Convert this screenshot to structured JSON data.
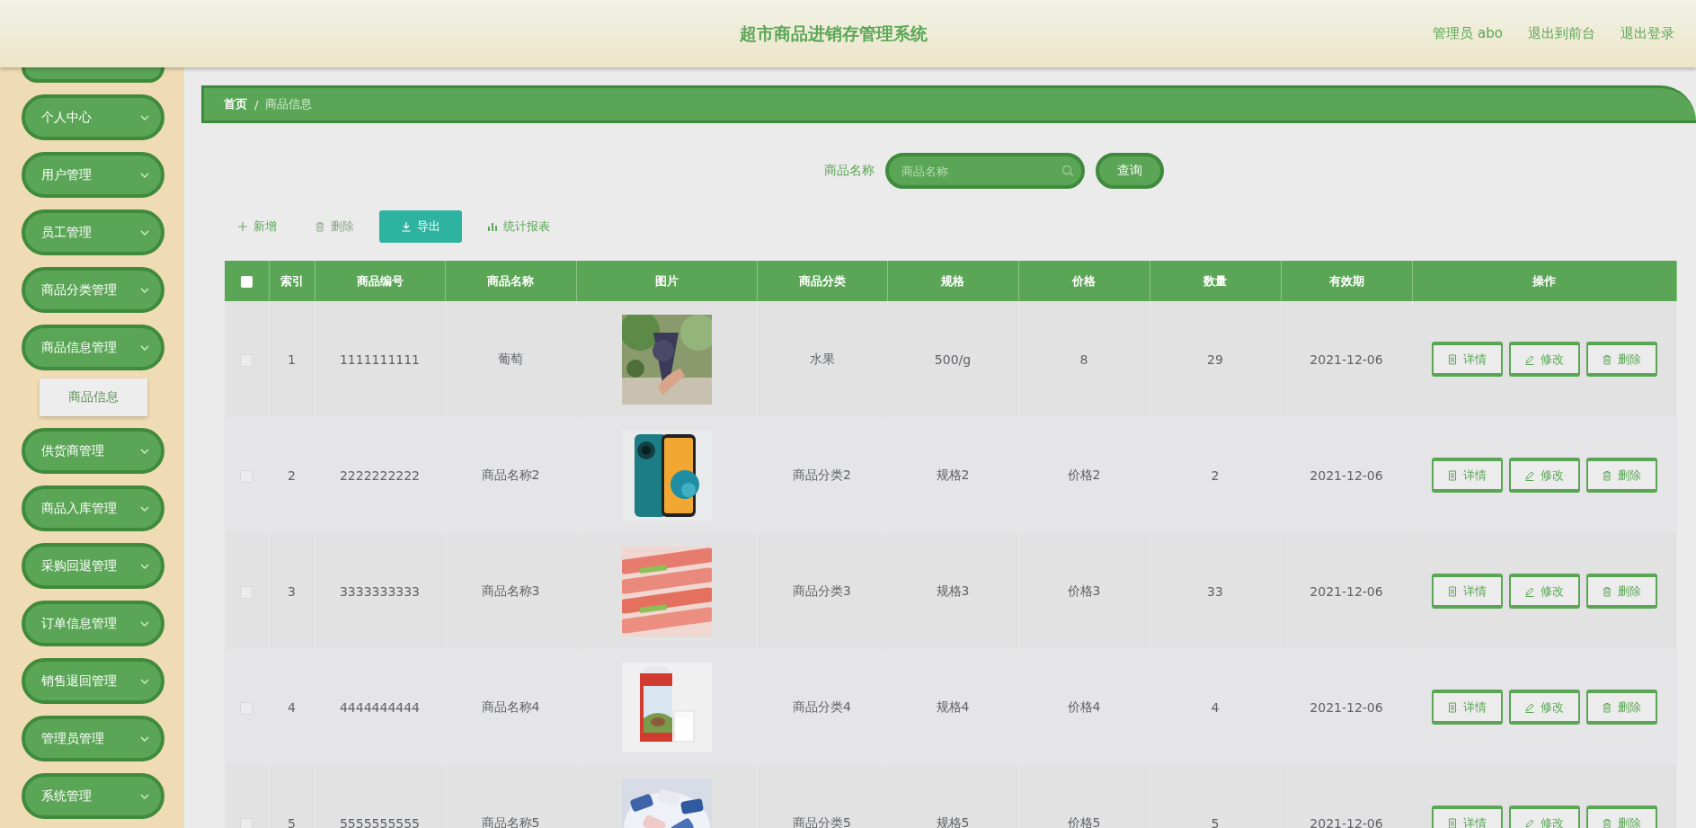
{
  "header": {
    "title": "超市商品进销存管理系统",
    "links": [
      "管理员 abo",
      "退出到前台",
      "退出登录"
    ]
  },
  "sidebar": {
    "items": [
      {
        "label": "个人中心"
      },
      {
        "label": "用户管理"
      },
      {
        "label": "员工管理"
      },
      {
        "label": "商品分类管理"
      },
      {
        "label": "商品信息管理",
        "children": [
          {
            "label": "商品信息",
            "selected": false
          }
        ]
      },
      {
        "label": "供货商管理"
      },
      {
        "label": "商品入库管理"
      },
      {
        "label": "采购回退管理"
      },
      {
        "label": "订单信息管理"
      },
      {
        "label": "销售退回管理"
      },
      {
        "label": "管理员管理"
      },
      {
        "label": "系统管理"
      }
    ]
  },
  "breadcrumb": {
    "separator": "/",
    "items": [
      {
        "label": "首页",
        "current": false
      },
      {
        "label": "商品信息",
        "current": true
      }
    ]
  },
  "search": {
    "label": "商品名称",
    "placeholder": "商品名称",
    "button": "查询"
  },
  "toolbar": [
    {
      "kind": "add",
      "label": "新增"
    },
    {
      "kind": "delete",
      "label": "删除"
    },
    {
      "kind": "export",
      "label": "导出"
    },
    {
      "kind": "chart",
      "label": "统计报表"
    }
  ],
  "table": {
    "header_checked": false,
    "columns": [
      "索引",
      "商品编号",
      "商品名称",
      "图片",
      "商品分类",
      "规格",
      "价格",
      "数量",
      "有效期",
      "操作"
    ],
    "rows": [
      {
        "checked": false,
        "index": "1",
        "code": "1111111111",
        "name": "葡萄",
        "picture": {
          "kind": "picture"
        },
        "category": "水果",
        "spec": "500/g",
        "price": "8",
        "quantity": "29",
        "expiry": "2021-12-06",
        "actions": [
          {
            "kind": "detail",
            "label": "详情"
          },
          {
            "kind": "edit",
            "label": "修改"
          },
          {
            "kind": "delete",
            "label": "删除"
          }
        ]
      },
      {
        "checked": false,
        "index": "2",
        "code": "2222222222",
        "name": "商品名称2",
        "picture": {
          "kind": "picture"
        },
        "category": "商品分类2",
        "spec": "规格2",
        "price": "价格2",
        "quantity": "2",
        "expiry": "2021-12-06",
        "actions": [
          {
            "kind": "detail",
            "label": "详情"
          },
          {
            "kind": "edit",
            "label": "修改"
          },
          {
            "kind": "delete",
            "label": "删除"
          }
        ]
      },
      {
        "checked": false,
        "index": "3",
        "code": "3333333333",
        "name": "商品名称3",
        "picture": {
          "kind": "picture"
        },
        "category": "商品分类3",
        "spec": "规格3",
        "price": "价格3",
        "quantity": "33",
        "expiry": "2021-12-06",
        "actions": [
          {
            "kind": "detail",
            "label": "详情"
          },
          {
            "kind": "edit",
            "label": "修改"
          },
          {
            "kind": "delete",
            "label": "删除"
          }
        ]
      },
      {
        "checked": false,
        "index": "4",
        "code": "4444444444",
        "name": "商品名称4",
        "picture": {
          "kind": "picture"
        },
        "category": "商品分类4",
        "spec": "规格4",
        "price": "价格4",
        "quantity": "4",
        "expiry": "2021-12-06",
        "actions": [
          {
            "kind": "detail",
            "label": "详情"
          },
          {
            "kind": "edit",
            "label": "修改"
          },
          {
            "kind": "delete",
            "label": "删除"
          }
        ]
      },
      {
        "checked": false,
        "index": "5",
        "code": "5555555555",
        "name": "商品名称5",
        "picture": {
          "kind": "picture"
        },
        "category": "商品分类5",
        "spec": "规格5",
        "price": "价格5",
        "quantity": "5",
        "expiry": "2021-12-06",
        "actions": [
          {
            "kind": "detail",
            "label": "详情"
          },
          {
            "kind": "edit",
            "label": "修改"
          },
          {
            "kind": "delete",
            "label": "删除"
          }
        ]
      }
    ]
  }
}
